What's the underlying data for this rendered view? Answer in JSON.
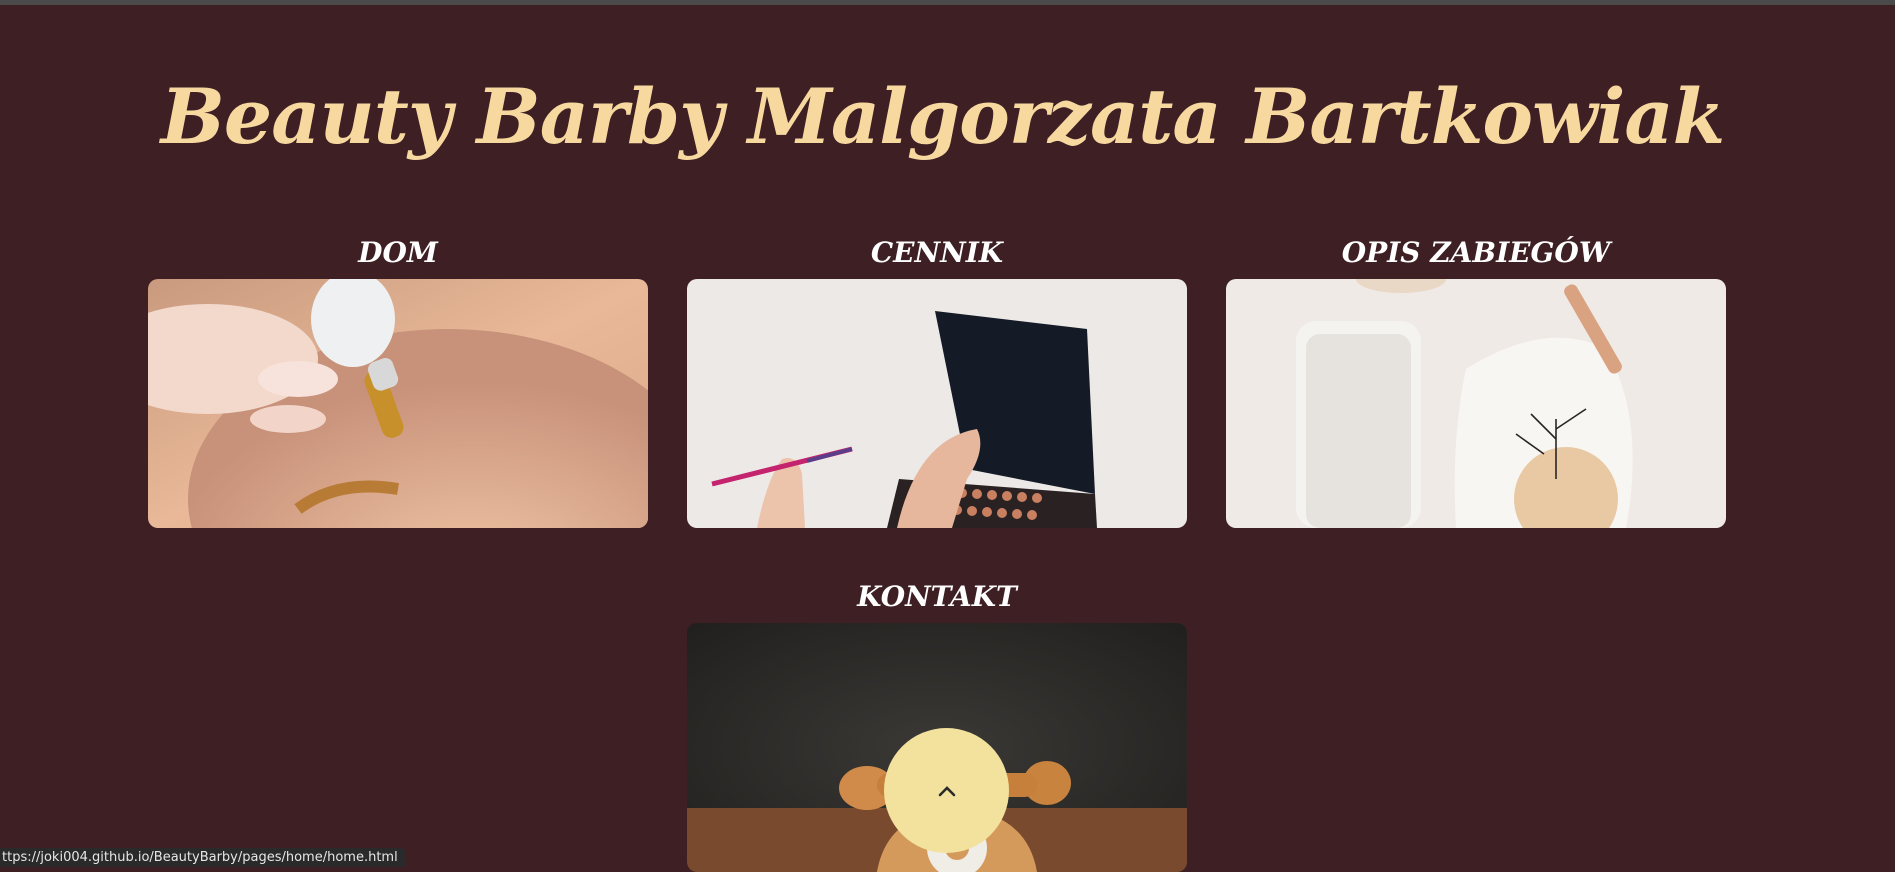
{
  "header": {
    "title": "Beauty Barby Malgorzata Bartkowiak"
  },
  "cards": [
    {
      "label": "DOM",
      "image": "oil-dropper-photo"
    },
    {
      "label": "CENNIK",
      "image": "eyeshadow-palette-photo"
    },
    {
      "label": "OPIS ZABIEGÓW",
      "image": "spa-towel-photo"
    },
    {
      "label": "KONTAKT",
      "image": "vintage-telephone-photo"
    }
  ],
  "scroll_top": {
    "icon": "chevron-up-icon"
  },
  "status_bar": {
    "url": "ttps://joki004.github.io/BeautyBarby/pages/home/home.html"
  },
  "colors": {
    "background": "#3d1f24",
    "title": "#f7d9a0",
    "card_title": "#ffffff",
    "scroll_button": "#f2e29e"
  }
}
